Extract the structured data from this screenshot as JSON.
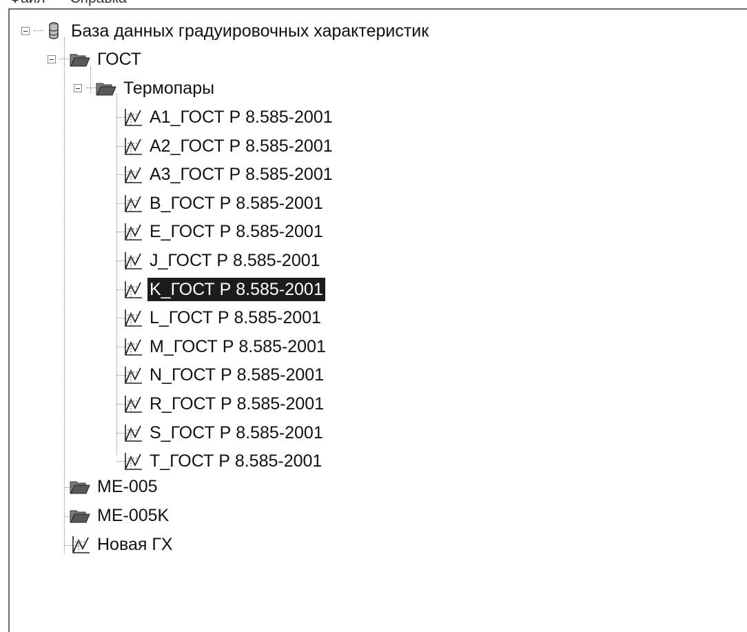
{
  "menu": [
    "Файл",
    "Справка"
  ],
  "tree": {
    "root": {
      "label": "База данных градуировочных характеристик",
      "icon": "database-icon",
      "expanded": true
    },
    "gost": {
      "label": "ГОСТ",
      "icon": "folder-open-icon",
      "expanded": true
    },
    "thermocouples": {
      "label": "Термопары",
      "icon": "folder-open-icon",
      "expanded": true
    },
    "items": [
      {
        "label": "A1_ГОСТ Р 8.585-2001",
        "icon": "calibration-chart-icon",
        "selected": false
      },
      {
        "label": "A2_ГОСТ Р 8.585-2001",
        "icon": "calibration-chart-icon",
        "selected": false
      },
      {
        "label": "A3_ГОСТ Р 8.585-2001",
        "icon": "calibration-chart-icon",
        "selected": false
      },
      {
        "label": "B_ГОСТ Р 8.585-2001",
        "icon": "calibration-chart-icon",
        "selected": false
      },
      {
        "label": "E_ГОСТ Р 8.585-2001",
        "icon": "calibration-chart-icon",
        "selected": false
      },
      {
        "label": "J_ГОСТ Р 8.585-2001",
        "icon": "calibration-chart-icon",
        "selected": false
      },
      {
        "label": "K_ГОСТ Р 8.585-2001",
        "icon": "calibration-chart-icon",
        "selected": true
      },
      {
        "label": "L_ГОСТ Р 8.585-2001",
        "icon": "calibration-chart-icon",
        "selected": false
      },
      {
        "label": "M_ГОСТ Р 8.585-2001",
        "icon": "calibration-chart-icon",
        "selected": false
      },
      {
        "label": "N_ГОСТ Р 8.585-2001",
        "icon": "calibration-chart-icon",
        "selected": false
      },
      {
        "label": "R_ГОСТ Р 8.585-2001",
        "icon": "calibration-chart-icon",
        "selected": false
      },
      {
        "label": "S_ГОСТ Р 8.585-2001",
        "icon": "calibration-chart-icon",
        "selected": false
      },
      {
        "label": "T_ГОСТ Р 8.585-2001",
        "icon": "calibration-chart-icon",
        "selected": false
      }
    ],
    "me005": {
      "label": "ME-005",
      "icon": "folder-icon"
    },
    "me005k": {
      "label": "ME-005K",
      "icon": "folder-icon"
    },
    "new_gx": {
      "label": "Новая ГХ",
      "icon": "calibration-chart-icon"
    }
  },
  "colors": {
    "selection": "#1c1c1c",
    "folder": "#5a5a5a",
    "tree_lines": "#8a8a8a"
  }
}
